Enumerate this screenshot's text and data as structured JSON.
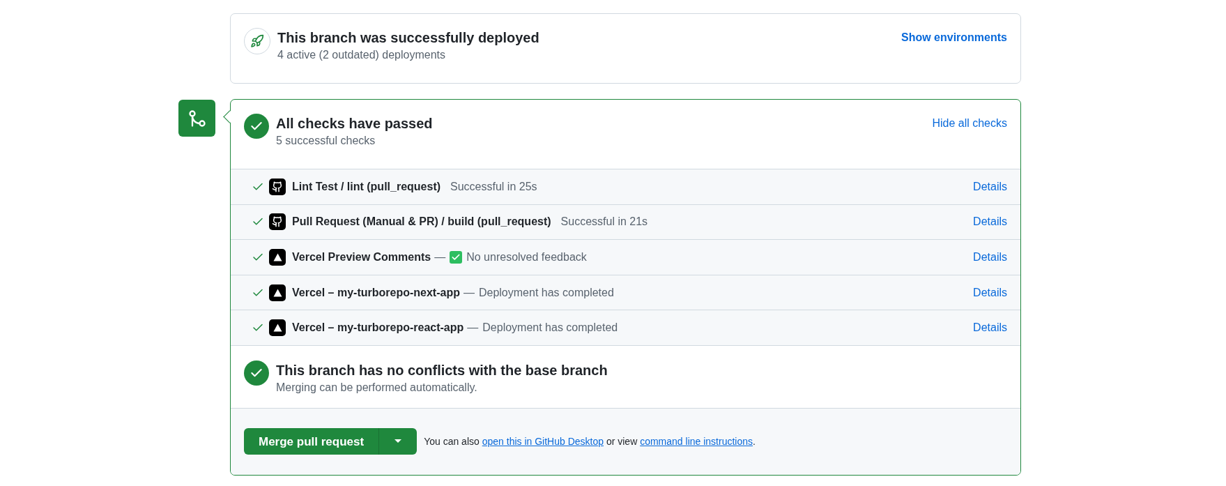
{
  "deployment": {
    "title": "This branch was successfully deployed",
    "subtitle": "4 active (2 outdated) deployments",
    "action": "Show environments"
  },
  "checks": {
    "title": "All checks have passed",
    "subtitle": "5 successful checks",
    "action": "Hide all checks",
    "rows": [
      {
        "kind": "github",
        "name": "Lint Test / lint (pull_request)",
        "status": "Successful in 25s",
        "link": "Details"
      },
      {
        "kind": "github",
        "name": "Pull Request (Manual & PR) / build (pull_request)",
        "status": "Successful in 21s",
        "link": "Details"
      },
      {
        "kind": "vercel",
        "name": "Vercel Preview Comments",
        "separator": "—",
        "status_checked": true,
        "status": "No unresolved feedback",
        "link": "Details"
      },
      {
        "kind": "vercel",
        "name": "Vercel – my-turborepo-next-app",
        "separator": "—",
        "status": "Deployment has completed",
        "link": "Details"
      },
      {
        "kind": "vercel",
        "name": "Vercel – my-turborepo-react-app",
        "separator": "—",
        "status": "Deployment has completed",
        "link": "Details"
      }
    ]
  },
  "conflicts": {
    "title": "This branch has no conflicts with the base branch",
    "subtitle": "Merging can be performed automatically."
  },
  "merge": {
    "button": "Merge pull request",
    "text_before": "You can also",
    "link_1": "open this in GitHub Desktop",
    "text_middle": "or view",
    "link_2": "command line instructions",
    "text_after": "."
  }
}
